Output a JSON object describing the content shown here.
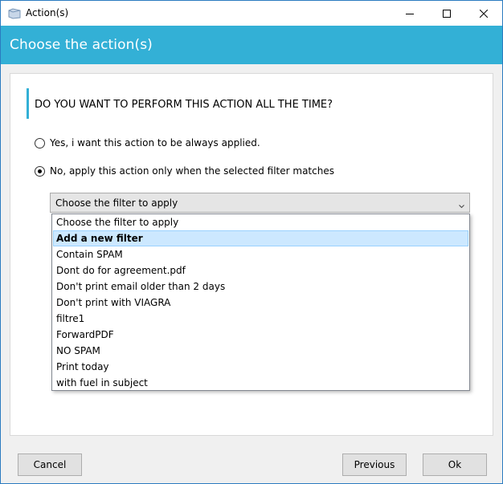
{
  "window": {
    "title": "Action(s)",
    "app_icon": "folder-icon",
    "controls": [
      "minimize-icon",
      "maximize-icon",
      "close-icon"
    ]
  },
  "header": {
    "title": "Choose the action(s)",
    "background_color": "#33b0d6"
  },
  "question": {
    "text": "DO YOU WANT TO PERFORM THIS ACTION ALL THE TIME?"
  },
  "options": [
    {
      "label": "Yes, i want this action to be always applied.",
      "checked": false
    },
    {
      "label": "No, apply this action only when the selected filter matches",
      "checked": true
    }
  ],
  "filter_combo": {
    "value": "Choose the filter to apply",
    "items": [
      "Choose the filter to apply",
      "Add a new filter",
      "Contain SPAM",
      "Dont do for agreement.pdf",
      "Don't print email older than 2 days",
      "Don't print with VIAGRA",
      "filtre1",
      "ForwardPDF",
      "NO SPAM",
      "Print today",
      "with fuel in subject"
    ],
    "highlighted_item": "Add a new filter"
  },
  "footer": {
    "cancel_label": "Cancel",
    "previous_label": "Previous",
    "ok_label": "Ok"
  }
}
